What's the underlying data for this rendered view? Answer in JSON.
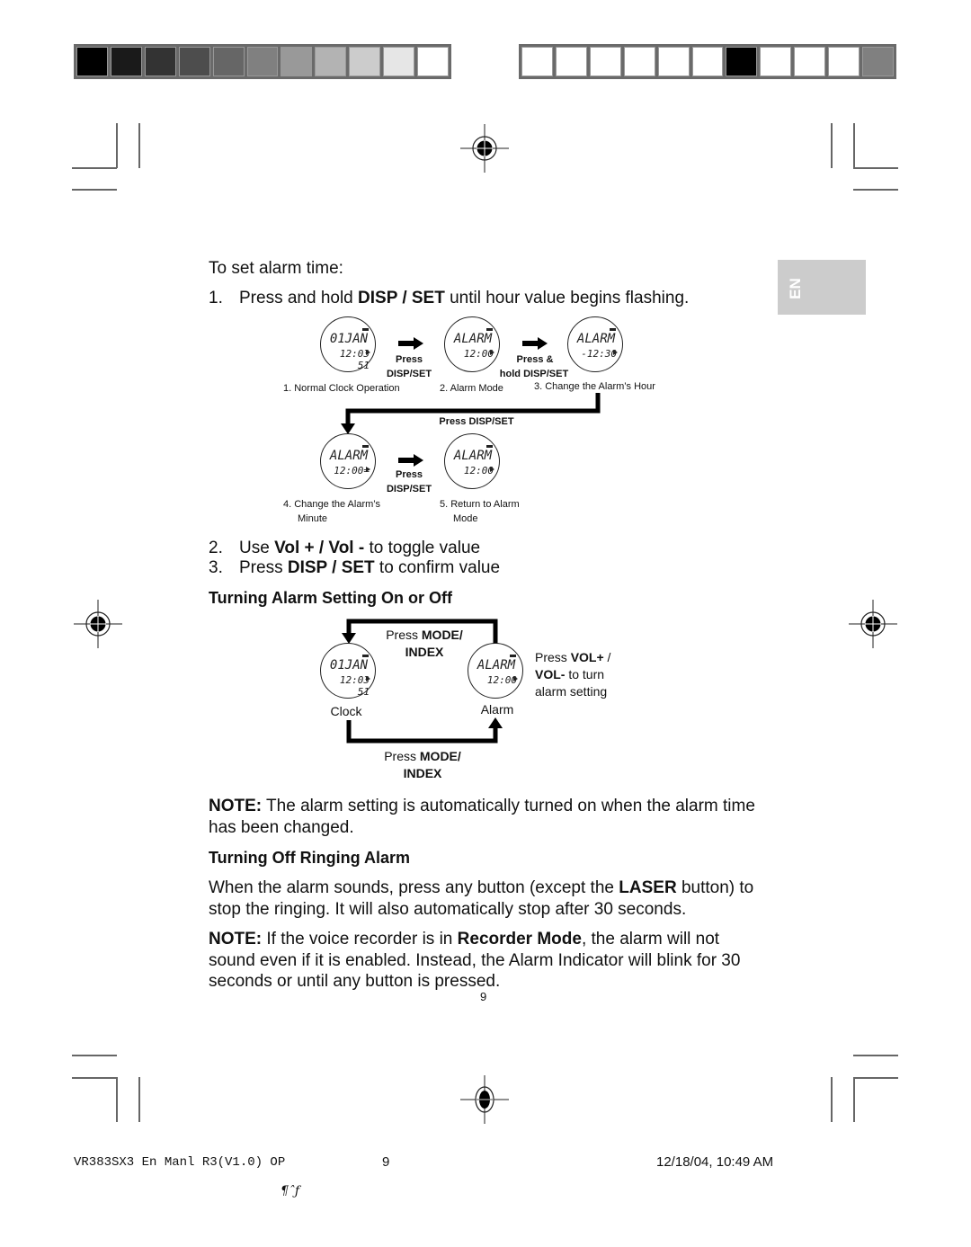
{
  "color_bars": {
    "left": [
      "#000000",
      "#1a1a1a",
      "#333333",
      "#4d4d4d",
      "#666666",
      "#808080",
      "#999999",
      "#b3b3b3",
      "#cccccc",
      "#e6e6e6",
      "#ffffff"
    ],
    "right": [
      "#ffffff",
      "#ffffff",
      "#ffffff",
      "#ffffff",
      "#ffffff",
      "#ffffff",
      "#000000",
      "#ffffff",
      "#ffffff",
      "#ffffff",
      "#808080"
    ]
  },
  "language_tab": "EN",
  "intro": "To set alarm time:",
  "steps": [
    {
      "num": "1.",
      "pre": "Press and hold ",
      "bold": "DISP / SET",
      "post": " until hour value begins flashing."
    },
    {
      "num": "2.",
      "pre": "Use ",
      "bold": "Vol + / Vol -",
      "post": " to toggle value"
    },
    {
      "num": "3.",
      "pre": "Press ",
      "bold": "DISP / SET",
      "post": " to confirm value"
    }
  ],
  "diagram1": {
    "displays": [
      {
        "line1": "01JAN",
        "line2": "12:03 51"
      },
      {
        "line1": "ALARM",
        "line2": "12:00 "
      },
      {
        "line1": "ALARM",
        "line2": "-12:30"
      },
      {
        "line1": "ALARM",
        "line2": "12:00="
      },
      {
        "line1": "ALARM",
        "line2": "12:00 "
      }
    ],
    "arrows": [
      {
        "line1": "Press",
        "line2": "DISP/SET"
      },
      {
        "line1": "Press &",
        "line2": "hold DISP/SET"
      },
      {
        "line1": "Press",
        "line2": "DISP/SET"
      }
    ],
    "connector_label": "Press DISP/SET",
    "captions": [
      "1. Normal Clock Operation",
      "2. Alarm Mode",
      "3. Change the Alarm’s Hour",
      "4. Change the Alarm’s",
      "Minute",
      "5. Return to Alarm",
      "Mode"
    ]
  },
  "section_on_off": {
    "heading": "Turning Alarm Setting On or Off",
    "top_label": {
      "pre": "Press ",
      "bold1": "MODE/",
      "bold2": "INDEX"
    },
    "bottom_label": {
      "pre": "Press ",
      "bold1": "MODE/",
      "bold2": "INDEX"
    },
    "clock_display": {
      "line1": "01JAN",
      "line2": "12:03 51"
    },
    "alarm_display": {
      "line1": "ALARM",
      "line2": "12:00 "
    },
    "clock_label": "Clock",
    "alarm_label": "Alarm",
    "side_note": {
      "pre": "Press ",
      "bold1": "VOL+",
      "mid1": " /",
      "bold2": "VOL-",
      "mid2": " to turn",
      "line3": "alarm setting"
    }
  },
  "note1": {
    "bold": "NOTE:",
    "text": " The alarm setting is automatically turned on when the alarm time has been changed."
  },
  "section_ringing": {
    "heading": "Turning Off Ringing Alarm",
    "para_pre": "When the alarm sounds, press any button (except the ",
    "para_bold": "LASER",
    "para_post": " button) to stop the ringing. It will also automatically stop after 30 seconds."
  },
  "note2": {
    "bold": "NOTE:",
    "pre": " If the voice recorder is in ",
    "bold2": "Recorder Mode",
    "post": ", the alarm will not sound even if it is enabled. Instead, the Alarm Indicator will blink for 30 seconds or until any button is pressed."
  },
  "page_number": "9",
  "footer": {
    "file": "VR383SX3 En Manl R3(V1.0) OP",
    "page": "9",
    "date": "12/18/04, 10:49 AM",
    "glyph": "¶ˆƒ"
  }
}
